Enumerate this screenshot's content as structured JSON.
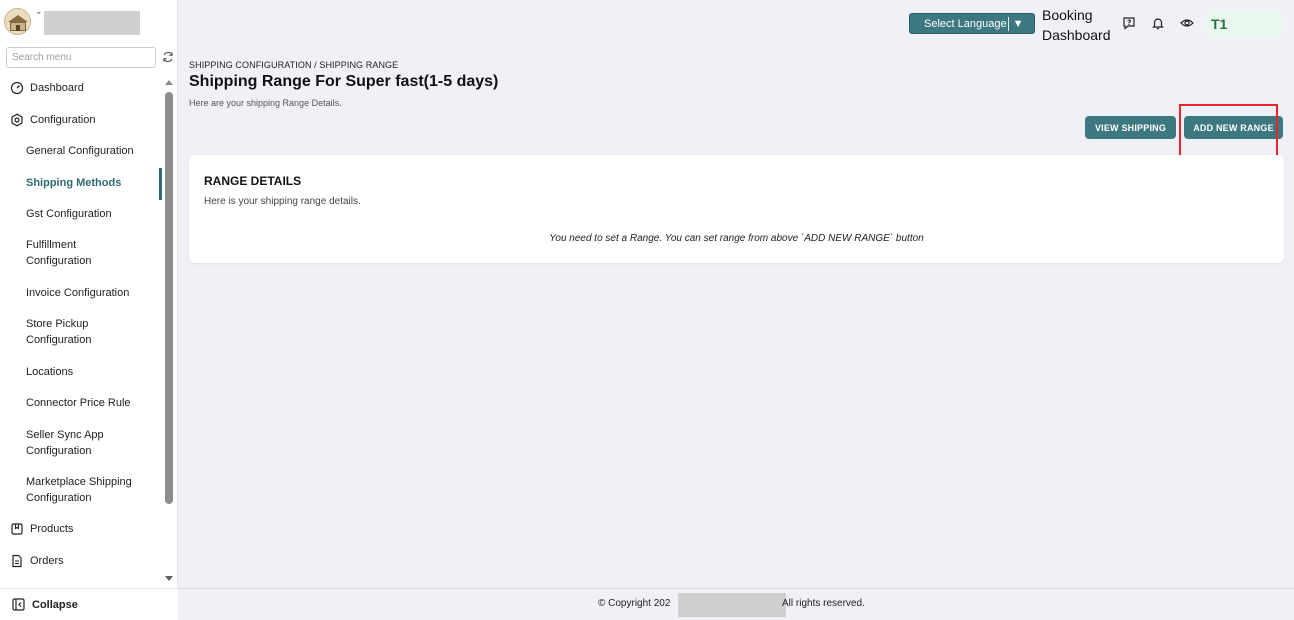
{
  "sidebar": {
    "search_placeholder": "Search menu",
    "menu": {
      "dashboard": "Dashboard",
      "configuration": "Configuration",
      "general_configuration": "General Configuration",
      "shipping_methods": "Shipping Methods",
      "gst_configuration": "Gst Configuration",
      "fulfillment_configuration": "Fulfillment Configuration",
      "invoice_configuration": "Invoice Configuration",
      "store_pickup_configuration": "Store Pickup Configuration",
      "locations": "Locations",
      "connector_price_rule": "Connector Price Rule",
      "seller_sync_app_configuration": "Seller Sync App Configuration",
      "marketplace_shipping_configuration": "Marketplace Shipping Configuration",
      "products": "Products",
      "orders": "Orders"
    },
    "collapse_label": "Collapse"
  },
  "header": {
    "language_button": "Select Language",
    "language_caret": "▼",
    "booking_dashboard": "Booking Dashboard",
    "user_initials": "T1"
  },
  "page": {
    "breadcrumb": "SHIPPING CONFIGURATION / SHIPPING RANGE",
    "title": "Shipping Range For Super fast(1-5 days)",
    "subtitle": "Here are your shipping Range Details.",
    "view_shipping_button": "VIEW SHIPPING",
    "add_new_range_button": "ADD NEW RANGE"
  },
  "card": {
    "title": "RANGE DETAILS",
    "subtitle": "Here is your shipping range details.",
    "empty_message": "You need to set a Range. You can set range from above `ADD NEW RANGE` button"
  },
  "footer": {
    "copyright_prefix": "© Copyright 202",
    "copyright_suffix": "All rights reserved."
  },
  "colors": {
    "accent": "#3d7780",
    "annotation": "#e8262b",
    "user_pill_bg": "#eaf7ee",
    "user_pill_text": "#27733f"
  }
}
